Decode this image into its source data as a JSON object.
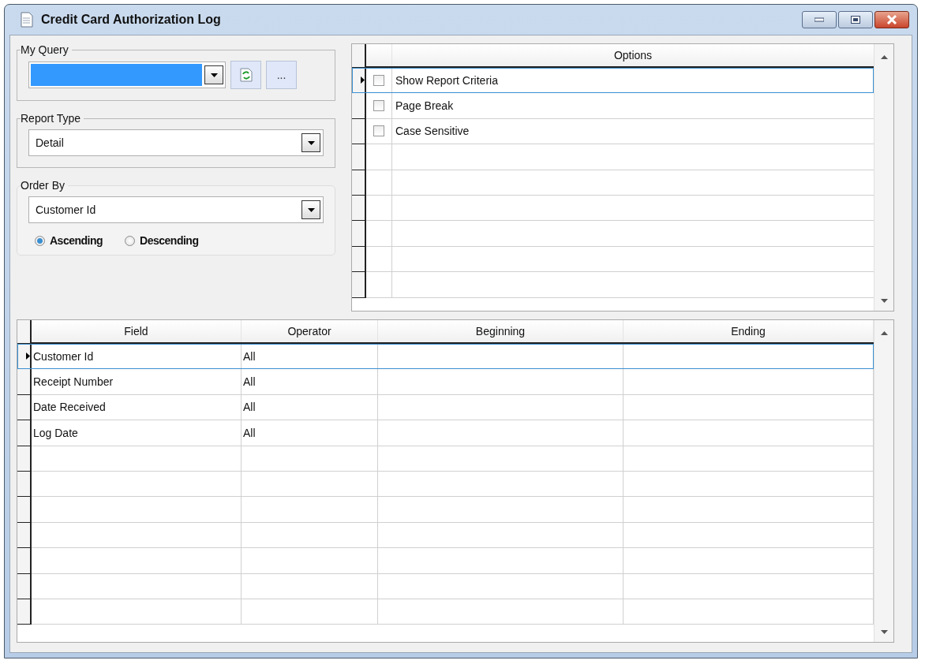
{
  "window": {
    "title": "Credit Card Authorization Log"
  },
  "my_query": {
    "label": "My Query",
    "more_button": "..."
  },
  "report_type": {
    "label": "Report Type",
    "value": "Detail"
  },
  "order_by": {
    "label": "Order By",
    "value": "Customer Id",
    "directions": [
      {
        "label": "Ascending",
        "selected": true
      },
      {
        "label": "Descending",
        "selected": false
      }
    ]
  },
  "options": {
    "header": "Options",
    "items": [
      {
        "label": "Show Report Criteria",
        "checked": false,
        "selected": true
      },
      {
        "label": "Page Break",
        "checked": false,
        "selected": false
      },
      {
        "label": "Case Sensitive",
        "checked": false,
        "selected": false
      }
    ]
  },
  "criteria": {
    "columns": [
      "Field",
      "Operator",
      "Beginning",
      "Ending"
    ],
    "rows": [
      {
        "field": "Customer Id",
        "operator": "All",
        "selected": true
      },
      {
        "field": "Receipt Number",
        "operator": "All",
        "selected": false
      },
      {
        "field": "Date Received",
        "operator": "All",
        "selected": false
      },
      {
        "field": "Log Date",
        "operator": "All",
        "selected": false
      }
    ]
  }
}
